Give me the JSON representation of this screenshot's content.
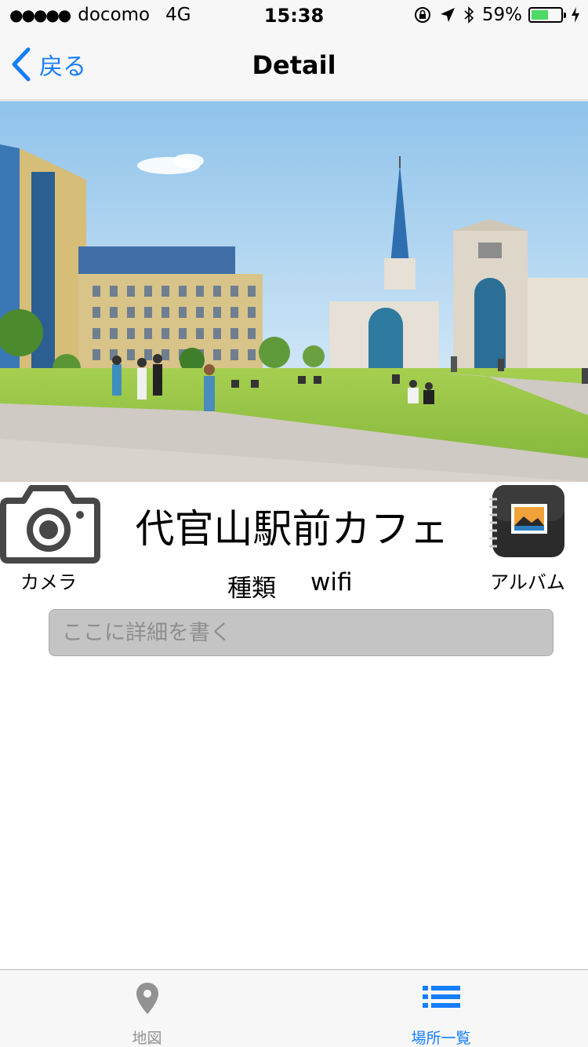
{
  "status_bar": {
    "signal_dots": "●●●●●",
    "carrier": "docomo",
    "network": "4G",
    "time": "15:38",
    "battery_percent": "59%",
    "battery_level": 0.59,
    "battery_color": "#4cd964"
  },
  "nav": {
    "back_label": "戻る",
    "title": "Detail",
    "accent_color": "#157efb"
  },
  "content": {
    "place_name": "代官山駅前カフェ",
    "camera_label": "カメラ",
    "album_label": "アルバム",
    "kind_label": "種類",
    "kind_value": "wifi",
    "detail_placeholder": "ここに詳細を書く"
  },
  "tab_bar": {
    "tabs": [
      {
        "label": "地図",
        "icon": "map-pin-icon",
        "selected": false
      },
      {
        "label": "場所一覧",
        "icon": "list-icon",
        "selected": true
      }
    ]
  }
}
